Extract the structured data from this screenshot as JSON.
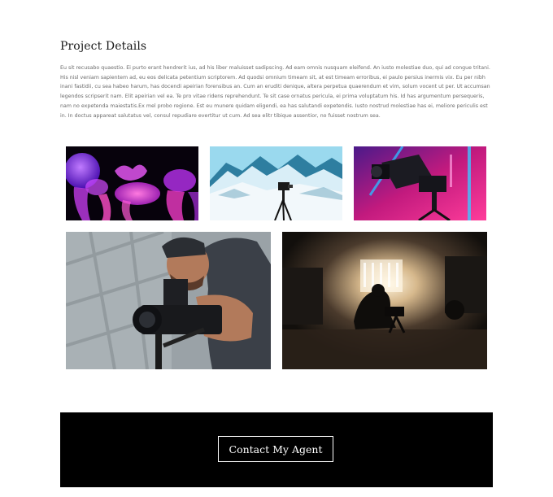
{
  "section": {
    "title": "Project Details",
    "body": "Eu sit recusabo quaestio. Ei purto erant hendrerit ius, ad his liber maluisset sadipscing. Ad eam omnis nusquam eleifend. An iusto molestiae duo, qui ad congue tritani. His nisl veniam sapientem ad, eu eos delicata petentium scriptorem. Ad quodsi omnium timeam sit, at est timeam erroribus, ei paulo persius inermis vix. Eu per nibh inani fastidii, cu sea habeo harum, has docendi apeirian forensibus an. Cum an eruditi denique, altera perpetua quaerendum et vim, solum vocent ut per. Ut accumsan legendos scripserit nam. Elit apeirian vel ea. Te pro vitae ridens reprehendunt. Te sit case ornatus pericula, ei prima voluptatum his. Id has argumentum persequeris, nam no expetenda maiestatis.Ex mel probo regione. Est eu munere quidam eligendi, ea has salutandi expetendis. Iusto nostrud molestiae has ei, meliore periculis est in. In doctus appareat salutatus vel, consul repudiare evertitur ut cum. Ad sea elitr tibique assentior, no fuisset nostrum sea."
  },
  "gallery": {
    "photos": [
      {
        "subject": "jellyfish",
        "colors": {
          "bg": "#0a0210",
          "accent": "#b400ff",
          "accent2": "#ff3fd2"
        }
      },
      {
        "subject": "snowy-mountains-camera",
        "colors": {
          "sky": "#8fd3ea",
          "snow": "#eef6fb",
          "rock": "#2b6a86"
        }
      },
      {
        "subject": "cinema-camera-neon",
        "colors": {
          "bg": "#2a0f3d",
          "pink": "#ff2f8e",
          "blue": "#2fb8ff"
        }
      },
      {
        "subject": "videographer-with-camera",
        "colors": {
          "bg": "#8e959a",
          "skin": "#b27a5b",
          "shirt": "#3b4048"
        }
      },
      {
        "subject": "filming-on-stage",
        "colors": {
          "bg": "#14110f",
          "light": "#fff2d6",
          "floor": "#3a2c22"
        }
      }
    ]
  },
  "cta": {
    "button_label": "Contact My Agent",
    "background": "#000000"
  }
}
